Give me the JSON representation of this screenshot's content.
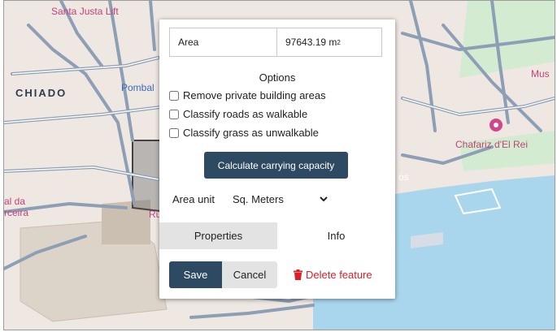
{
  "map": {
    "labels": {
      "santa_justa": "Santa Justa Lift",
      "chiado": "CHIADO",
      "pombal": "Pombal",
      "mus": "Mus",
      "chafariz": "Chafariz d'El Rei",
      "al_da": "al da",
      "rceira": "rceira",
      "ru": "Ru",
      "os": "os"
    }
  },
  "popup": {
    "area_label": "Area",
    "area_value": "97643.19 m",
    "area_unit_sup": "2",
    "options_title": "Options",
    "options": [
      {
        "label": "Remove private building areas",
        "checked": false
      },
      {
        "label": "Classify roads as walkable",
        "checked": false
      },
      {
        "label": "Classify grass as unwalkable",
        "checked": false
      }
    ],
    "calc_button": "Calculate carrying capacity",
    "area_unit_label": "Area unit",
    "area_unit_selected": "Sq. Meters",
    "tabs": [
      "Properties",
      "Info"
    ],
    "save_label": "Save",
    "cancel_label": "Cancel",
    "delete_label": "Delete feature"
  },
  "colors": {
    "primary": "#2e4a63",
    "danger": "#d9202a",
    "water": "#a9d6ec",
    "road": "#8d9fb5"
  }
}
